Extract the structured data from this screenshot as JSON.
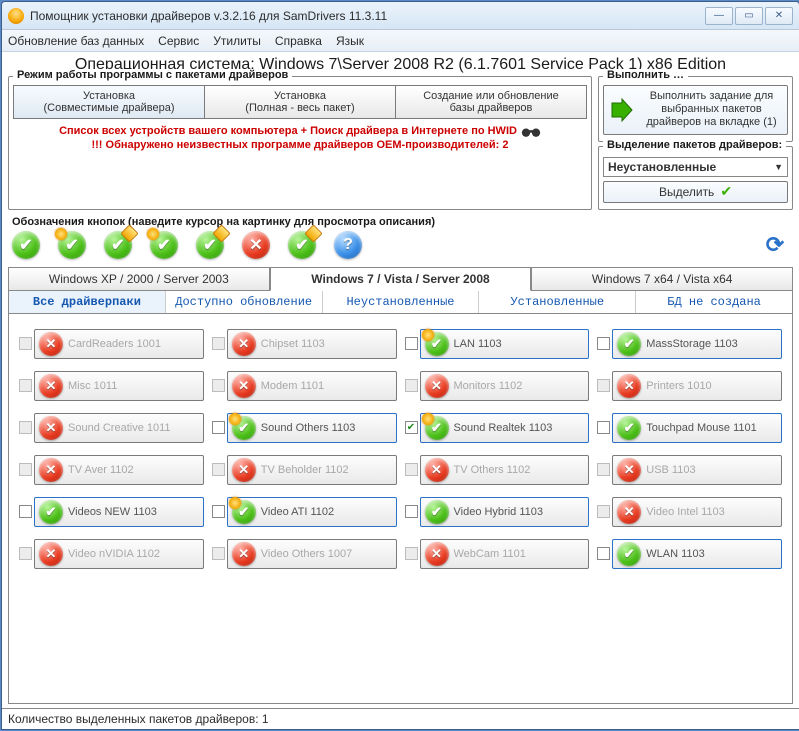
{
  "title": "Помощник установки драйверов v.3.2.16 для SamDrivers 11.3.11",
  "menu": [
    "Обновление баз данных",
    "Сервис",
    "Утилиты",
    "Справка",
    "Язык"
  ],
  "os_line": "Операционная система: Windows 7\\Server 2008 R2  (6.1.7601 Service Pack 1) x86 Edition",
  "mode_group": "Режим работы программы с пакетами драйверов",
  "mode_tabs": [
    {
      "l1": "Установка",
      "l2": "(Совместимые драйвера)"
    },
    {
      "l1": "Установка",
      "l2": "(Полная - весь пакет)"
    },
    {
      "l1": "Создание или обновление",
      "l2": "базы драйверов"
    }
  ],
  "warn1": "Список всех устройств вашего компьютера + Поиск драйвера в Интернете по HWID",
  "warn2": "!!! Обнаружено неизвестных программе драйверов OEM-производителей: 2",
  "legend_title": "Обозначения кнопок (наведите курсор на картинку для просмотра описания)",
  "exec_group": "Выполнить …",
  "exec_btn": "Выполнить задание для выбранных пакетов драйверов на вкладке (1)",
  "sel_group": "Выделение пакетов драйверов:",
  "sel_value": "Неустановленные",
  "sel_btn": "Выделить",
  "os_tabs": [
    "Windows XP / 2000 / Server 2003",
    "Windows 7 / Vista / Server 2008",
    "Windows 7 x64 / Vista x64"
  ],
  "sub_tabs": [
    "Все драйверпаки",
    "Доступно обновление",
    "Неустановленные",
    "Установленные",
    "БД не создана"
  ],
  "items": [
    {
      "n": "CardReaders 1001",
      "s": "red",
      "d": true,
      "c": false
    },
    {
      "n": "Chipset 1103",
      "s": "red",
      "d": true,
      "c": false
    },
    {
      "n": "LAN 1103",
      "s": "green-star",
      "d": false,
      "c": false,
      "blue": true
    },
    {
      "n": "MassStorage 1103",
      "s": "green",
      "d": false,
      "c": false,
      "blue": true
    },
    {
      "n": "Misc 1011",
      "s": "red",
      "d": true,
      "c": false
    },
    {
      "n": "Modem 1101",
      "s": "red",
      "d": true,
      "c": false
    },
    {
      "n": "Monitors 1102",
      "s": "red",
      "d": true,
      "c": false
    },
    {
      "n": "Printers 1010",
      "s": "red",
      "d": true,
      "c": false
    },
    {
      "n": "Sound Creative 1011",
      "s": "red",
      "d": true,
      "c": false
    },
    {
      "n": "Sound Others 1103",
      "s": "green-star",
      "d": false,
      "c": false,
      "blue": true
    },
    {
      "n": "Sound Realtek 1103",
      "s": "green-star",
      "d": false,
      "c": true,
      "blue": true
    },
    {
      "n": "Touchpad Mouse 1101",
      "s": "green",
      "d": false,
      "c": false,
      "blue": true
    },
    {
      "n": "TV Aver 1102",
      "s": "red",
      "d": true,
      "c": false
    },
    {
      "n": "TV Beholder 1102",
      "s": "red",
      "d": true,
      "c": false
    },
    {
      "n": "TV Others 1102",
      "s": "red",
      "d": true,
      "c": false
    },
    {
      "n": "USB 1103",
      "s": "red",
      "d": true,
      "c": false
    },
    {
      "n": "Videos NEW 1103",
      "s": "green",
      "d": false,
      "c": false,
      "blue": true
    },
    {
      "n": "Video ATI 1102",
      "s": "green-star",
      "d": false,
      "c": false,
      "blue": true
    },
    {
      "n": "Video Hybrid 1103",
      "s": "green",
      "d": false,
      "c": false,
      "blue": true
    },
    {
      "n": "Video Intel 1103",
      "s": "red",
      "d": true,
      "c": false
    },
    {
      "n": "Video nVIDIA 1102",
      "s": "red",
      "d": true,
      "c": false
    },
    {
      "n": "Video Others 1007",
      "s": "red",
      "d": true,
      "c": false
    },
    {
      "n": "WebCam 1101",
      "s": "red",
      "d": true,
      "c": false
    },
    {
      "n": "WLAN 1103",
      "s": "green",
      "d": false,
      "c": false,
      "blue": true
    }
  ],
  "status": "Количество выделенных пакетов драйверов: 1"
}
